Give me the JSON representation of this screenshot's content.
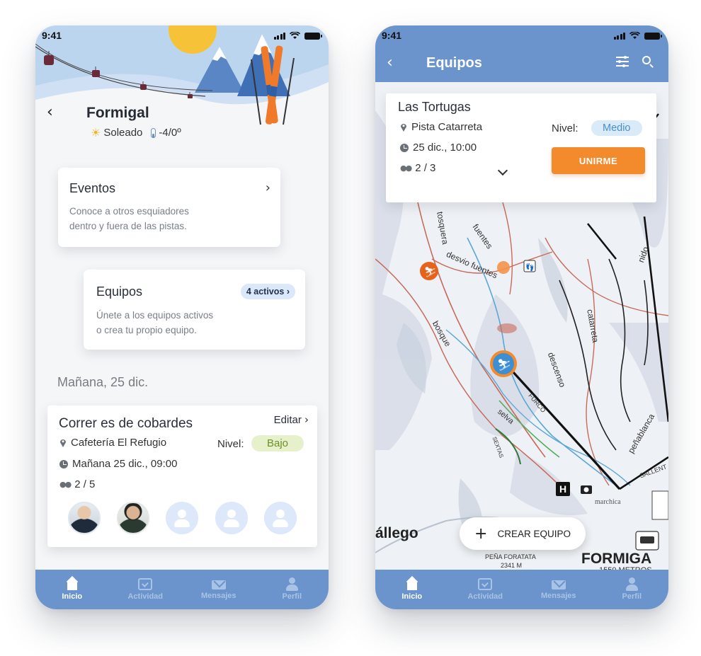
{
  "status": {
    "time": "9:41"
  },
  "left": {
    "resort": "Formigal",
    "weather": {
      "condition": "Soleado",
      "temperature": "-4/0º"
    },
    "eventos": {
      "title": "Eventos",
      "line1": "Conoce a otros esquiadores",
      "line2": "dentro y fuera de las pistas."
    },
    "equipos": {
      "title": "Equipos",
      "badge": "4 activos",
      "line1": "Únete a los equipos activos",
      "line2": "o crea tu propio equipo."
    },
    "date_heading": "Mañana, 25 dic.",
    "event": {
      "title": "Correr es de cobardes",
      "edit": "Editar",
      "location": "Cafetería El Refugio",
      "time": "Mañana 25 dic., 09:00",
      "members": "2 / 5",
      "level_label": "Nivel:",
      "level": "Bajo"
    }
  },
  "right": {
    "header_title": "Equipos",
    "team": {
      "name": "Las Tortugas",
      "location": "Pista Catarreta",
      "time": "25 dic., 10:00",
      "members": "2 / 3",
      "level_label": "Nivel:",
      "level": "Medio",
      "join": "UNIRME"
    },
    "create_button": "CREAR EQUIPO",
    "map_labels": {
      "tosquera": "tosquera",
      "fuentes": "fuentes",
      "desvio_fuentes": "desvio fuentes",
      "bosque": "bosque",
      "selva": "selva",
      "furco": "FURCO",
      "sextas": "SEXTAS",
      "descenso": "descenso",
      "catarreta": "catarreta",
      "nido": "nido",
      "penablanca": "peñablanca",
      "sallent": "SALLENT",
      "marchica": "marchica",
      "gallego": "állego",
      "formigal": "FORMIGA",
      "metros": "1550 METROS",
      "pena_foratata": "PEÑA FORATATA",
      "pena_altitude": "2341 M"
    }
  },
  "tabs": [
    "Inicio",
    "Actividad",
    "Mensajes",
    "Perfil"
  ],
  "colors": {
    "primary": "#6b93cc",
    "accent": "#f38a2c",
    "low": "#6f8e28",
    "medium": "#4b8fc7"
  }
}
